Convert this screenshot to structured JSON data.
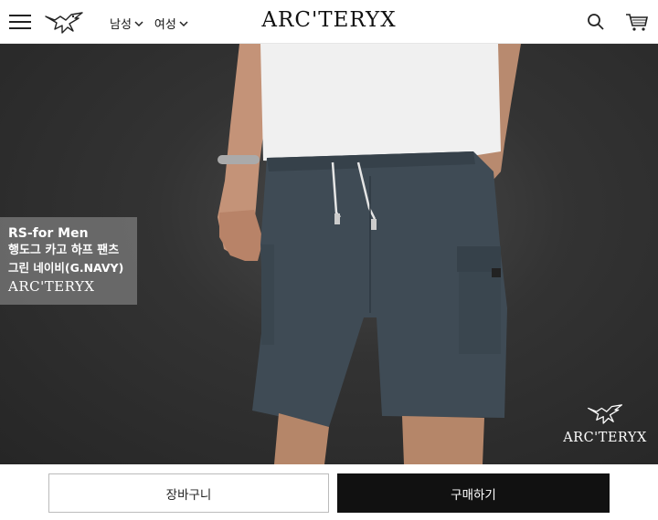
{
  "header": {
    "nav": [
      {
        "label": "남성"
      },
      {
        "label": "여성"
      }
    ],
    "brand": "ARC'TERYX",
    "icons": [
      "menu-icon",
      "arcteryx-bird-logo",
      "search-icon",
      "cart-icon"
    ]
  },
  "hero": {
    "caption": {
      "line1": "RS-for Men",
      "line2": "행도그 카고 하프 팬츠",
      "line3": "그린 네이비(G.NAVY)",
      "brand": "ARC'TERYX"
    },
    "corner_brand": "ARC'TERYX",
    "colors": {
      "background": "#2e2e2e",
      "shorts": "#3e4a54",
      "tshirt": "#f2f2f2"
    }
  },
  "actions": {
    "cart_label": "장바구니",
    "buy_label": "구매하기"
  }
}
